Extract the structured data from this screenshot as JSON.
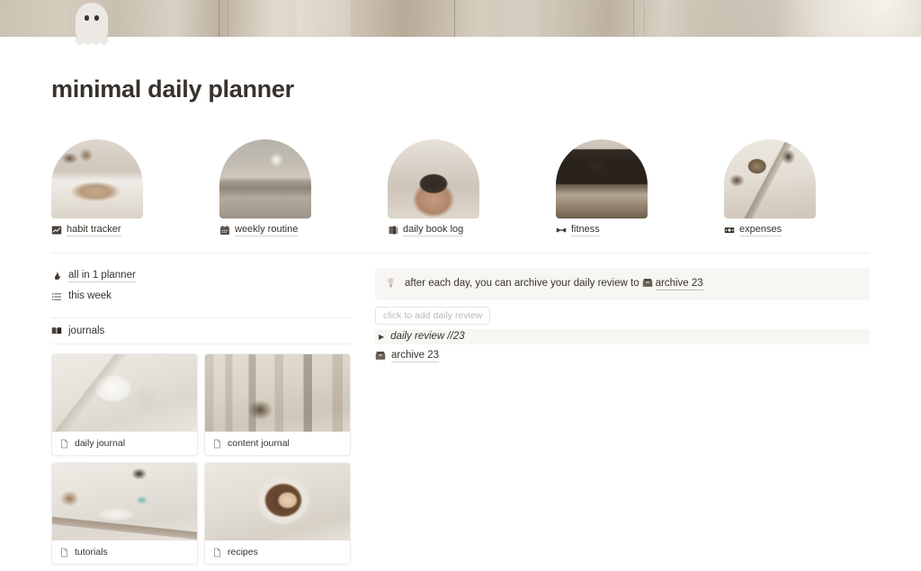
{
  "cover": {
    "alt_description": "beige draped fabric cover image"
  },
  "page_icon": "ghost-emoji",
  "header": {
    "title": "minimal daily planner"
  },
  "gallery": {
    "items": [
      {
        "label": "habit tracker",
        "icon": "bar-chart-icon",
        "thumb": "sleeping-cat-photo"
      },
      {
        "label": "weekly routine",
        "icon": "calendar-icon",
        "thumb": "sunset-seascape-photo"
      },
      {
        "label": "daily book log",
        "icon": "books-icon",
        "thumb": "terracotta-plant-pot-photo"
      },
      {
        "label": "fitness",
        "icon": "dumbbell-icon",
        "thumb": "vintage-tv-photo"
      },
      {
        "label": "expenses",
        "icon": "banknote-icon",
        "thumb": "framed-art-staircase-photo"
      }
    ]
  },
  "sidebar": {
    "links": [
      {
        "label": "all in 1 planner",
        "icon": "fire-icon"
      },
      {
        "label": "this week",
        "icon": "list-icon"
      }
    ],
    "journals_header": {
      "label": "journals",
      "icon": "open-book-icon"
    },
    "journal_cards": [
      {
        "label": "daily journal",
        "icon": "page-icon",
        "thumb": "life-notebook-photo"
      },
      {
        "label": "content journal",
        "icon": "page-icon",
        "thumb": "paper-collage-moodboard-photo"
      },
      {
        "label": "tutorials",
        "icon": "page-icon",
        "thumb": "desk-keyboard-setup-photo"
      },
      {
        "label": "recipes",
        "icon": "page-icon",
        "thumb": "coffee-cup-latte-photo"
      }
    ]
  },
  "main": {
    "callout": {
      "icon": "lightbulb-icon",
      "text_before": "after each day, you can archive your daily review to",
      "inline_icon": "card-file-box-icon",
      "link_label": "archive 23"
    },
    "add_button": {
      "label": "click to add daily review"
    },
    "toggle": {
      "arrow": "triangle-right-icon",
      "label": "daily review //23"
    },
    "archive_item": {
      "icon": "card-file-box-icon",
      "label": "archive 23"
    }
  },
  "colors": {
    "text": "#37322c",
    "cover_beige": "#cbc2b4",
    "callout_bg": "#f7f6f3",
    "divider": "#eeeeec",
    "placeholder": "#bdbab4"
  }
}
